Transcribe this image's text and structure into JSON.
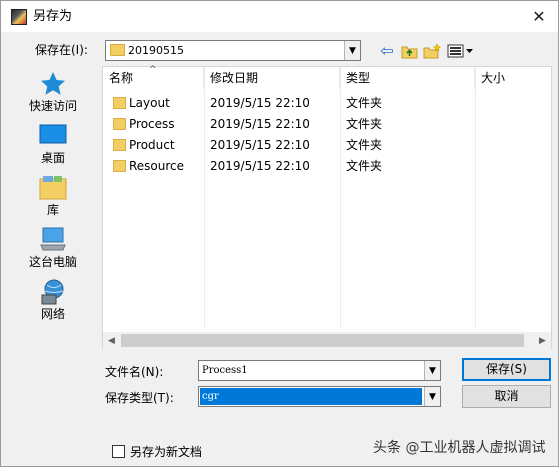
{
  "window": {
    "title": "另存为",
    "close_glyph": "✕"
  },
  "savein": {
    "label": "保存在(I):",
    "value": "20190515"
  },
  "toolbar": {
    "back_glyph": "⇦"
  },
  "places": [
    {
      "label": "快速访问",
      "icon": "star-icon"
    },
    {
      "label": "桌面",
      "icon": "desktop-icon"
    },
    {
      "label": "库",
      "icon": "library-icon"
    },
    {
      "label": "这台电脑",
      "icon": "computer-icon"
    },
    {
      "label": "网络",
      "icon": "network-icon"
    }
  ],
  "columns": {
    "name": "名称",
    "modified": "修改日期",
    "type": "类型",
    "size": "大小"
  },
  "files": [
    {
      "name": "Layout",
      "modified": "2019/5/15 22:10",
      "type": "文件夹"
    },
    {
      "name": "Process",
      "modified": "2019/5/15 22:10",
      "type": "文件夹"
    },
    {
      "name": "Product",
      "modified": "2019/5/15 22:10",
      "type": "文件夹"
    },
    {
      "name": "Resource",
      "modified": "2019/5/15 22:10",
      "type": "文件夹"
    }
  ],
  "filename": {
    "label": "文件名(N):",
    "value": "Process1"
  },
  "filetype": {
    "label": "保存类型(T):",
    "value": "cgr"
  },
  "buttons": {
    "save": "保存(S)",
    "cancel": "取消"
  },
  "option": {
    "label": "另存为新文档",
    "checked": false
  },
  "watermark": "头条 @工业机器人虚拟调试",
  "colors": {
    "accent": "#0078d7",
    "folder": "#f3cf63"
  }
}
